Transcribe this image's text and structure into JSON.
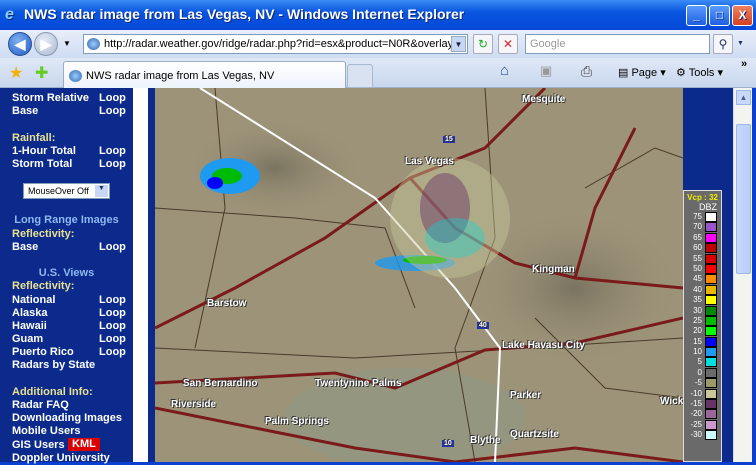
{
  "window": {
    "title": "NWS radar image from Las Vegas, NV - Windows Internet Explorer",
    "minimize": "_",
    "maximize": "□",
    "close": "X"
  },
  "nav": {
    "back": "◀",
    "forward": "▶",
    "url": "http://radar.weather.gov/ridge/radar.php?rid=esx&product=N0R&overlay=",
    "refresh": "↻",
    "stop": "✕",
    "search_placeholder": "Google",
    "search_btn": "⚲"
  },
  "tabs": {
    "active": "NWS radar image from Las Vegas, NV"
  },
  "toolbar": {
    "home": "⌂",
    "feeds": "▣",
    "print": "⎙",
    "page": "Page",
    "tools": "Tools",
    "more": "»"
  },
  "sidebar": {
    "rows1": [
      {
        "label": "Storm Relative",
        "loop": "Loop"
      },
      {
        "label": "Base",
        "loop": "Loop"
      }
    ],
    "rainfall": "Rainfall:",
    "rows2": [
      {
        "label": "1-Hour Total",
        "loop": "Loop"
      },
      {
        "label": "Storm Total",
        "loop": "Loop"
      }
    ],
    "mouseover": "MouseOver Off",
    "long_range": "Long Range Images",
    "reflectivity": "Reflectivity:",
    "base": {
      "label": "Base",
      "loop": "Loop"
    },
    "us_views": "U.S. Views",
    "reflectivity2": "Reflectivity:",
    "views": [
      {
        "label": "National",
        "loop": "Loop"
      },
      {
        "label": "Alaska",
        "loop": "Loop"
      },
      {
        "label": "Hawaii",
        "loop": "Loop"
      },
      {
        "label": "Guam",
        "loop": "Loop"
      },
      {
        "label": "Puerto Rico",
        "loop": "Loop"
      }
    ],
    "radars_by_state": "Radars by State",
    "additional": "Additional Info:",
    "links": [
      "Radar FAQ",
      "Downloading Images",
      "Mobile Users",
      "GIS Users",
      "Doppler University"
    ],
    "kml": "KML"
  },
  "map": {
    "cities": [
      "Mesquite",
      "Las Vegas",
      "Kingman",
      "Barstow",
      "Lake Havasu City",
      "San Bernardino",
      "Twentynine Palms",
      "Riverside",
      "Palm Springs",
      "Parker",
      "Blythe",
      "Quartzsite",
      "Wick"
    ],
    "shields": [
      "15",
      "40",
      "10"
    ]
  },
  "legend": {
    "vcp": "Vcp : 32",
    "unit": "DBZ",
    "levels": [
      "75",
      "70",
      "65",
      "60",
      "55",
      "50",
      "45",
      "40",
      "35",
      "30",
      "25",
      "20",
      "15",
      "10",
      "5",
      "0",
      "-5",
      "-10",
      "-15",
      "-20",
      "-25",
      "-30"
    ],
    "colors": [
      "#ffffff",
      "#9955cc",
      "#ff00ff",
      "#c00000",
      "#d80000",
      "#ff0000",
      "#ff8c00",
      "#e8b800",
      "#ffff00",
      "#008800",
      "#00bb00",
      "#00ff00",
      "#0000ff",
      "#1e9af0",
      "#00e0e0",
      "#6a6a6a",
      "#9a9a6a",
      "#c8c89a",
      "#663366",
      "#996699",
      "#cc99cc",
      "#ccffff"
    ]
  }
}
